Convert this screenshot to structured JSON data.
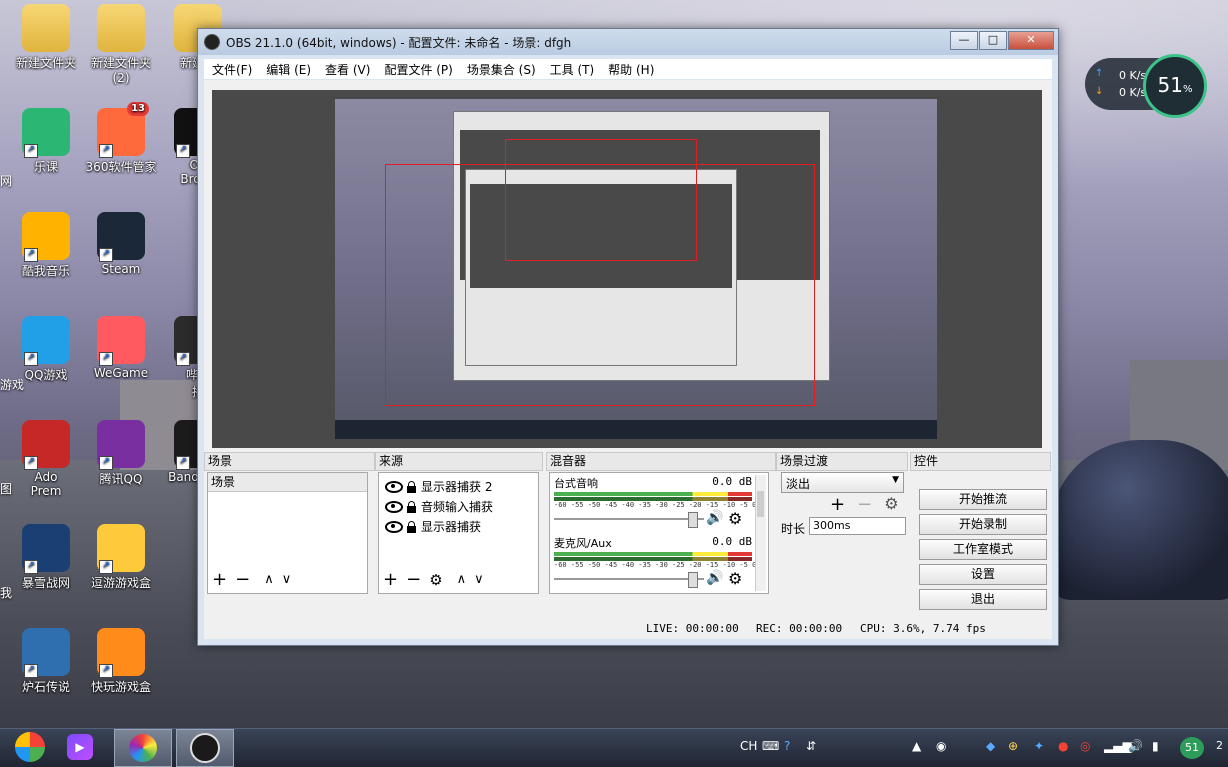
{
  "desktop": {
    "icons": [
      {
        "label": "新建文件夹",
        "kind": "folder"
      },
      {
        "label": "新建文件夹\n(2)",
        "kind": "folder"
      },
      {
        "label": "新建文",
        "kind": "folder"
      },
      {
        "label": "乐课",
        "kind": "app"
      },
      {
        "label": "360软件管家",
        "kind": "app",
        "badge": "13"
      },
      {
        "label": "Op\nBroad",
        "kind": "app"
      },
      {
        "label": "酷我音乐",
        "kind": "app"
      },
      {
        "label": "Steam",
        "kind": "app"
      },
      {
        "label": "QQ游戏",
        "kind": "app"
      },
      {
        "label": "WeGame",
        "kind": "app"
      },
      {
        "label": "哔哩\n播",
        "kind": "app"
      },
      {
        "label": "腾讯QQ",
        "kind": "app"
      },
      {
        "label": "Bandicam",
        "kind": "app"
      },
      {
        "label": "Ado\nPrem",
        "kind": "app"
      },
      {
        "label": "暴雪战网",
        "kind": "app"
      },
      {
        "label": "逗游游戏盒",
        "kind": "app"
      },
      {
        "label": "炉石传说",
        "kind": "app"
      },
      {
        "label": "快玩游戏盒",
        "kind": "app"
      }
    ],
    "left_edge_labels": [
      "网",
      "游戏",
      "图",
      "我"
    ]
  },
  "net_widget": {
    "up": "0 K/s",
    "down": "0 K/s",
    "percent": "51",
    "percent_unit": "%"
  },
  "obs": {
    "title": "OBS 21.1.0 (64bit, windows) - 配置文件: 未命名 - 场景: dfgh",
    "window_buttons": {
      "minimize": "—",
      "maximize": "□",
      "close": "✕"
    },
    "menu": [
      "文件(F)",
      "编辑 (E)",
      "查看 (V)",
      "配置文件 (P)",
      "场景集合 (S)",
      "工具 (T)",
      "帮助 (H)"
    ],
    "docks": {
      "scenes": {
        "title": "场景",
        "header": "场景"
      },
      "sources": {
        "title": "来源",
        "items": [
          "显示器捕获 2",
          "音频输入捕获",
          "显示器捕获"
        ]
      },
      "mixer": {
        "title": "混音器",
        "scale": "-60 -55 -50 -45 -40 -35 -30 -25 -20 -15 -10  -5   0",
        "channels": [
          {
            "name": "台式音响",
            "db": "0.0 dB"
          },
          {
            "name": "麦克风/Aux",
            "db": "0.0 dB"
          }
        ]
      },
      "transitions": {
        "title": "场景过渡",
        "selected": "淡出",
        "duration_label": "时长",
        "duration_value": "300ms"
      },
      "controls": {
        "title": "控件",
        "buttons": [
          "开始推流",
          "开始录制",
          "工作室模式",
          "设置",
          "退出"
        ]
      }
    },
    "status": {
      "live": "LIVE: 00:00:00",
      "rec": "REC: 00:00:00",
      "cpu": "CPU: 3.6%, 7.74 fps"
    }
  },
  "taskbar": {
    "lang": "CH",
    "tray_number": "51",
    "clock_fragment": "2"
  }
}
